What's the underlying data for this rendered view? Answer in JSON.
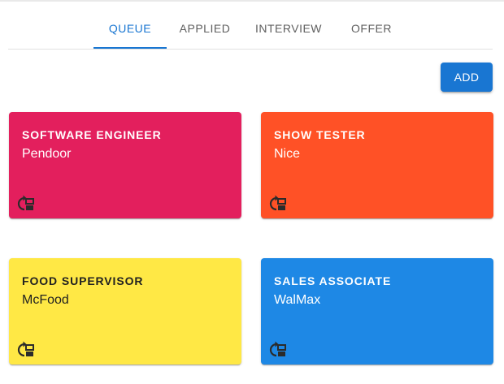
{
  "tabs": [
    {
      "label": "QUEUE",
      "active": true
    },
    {
      "label": "APPLIED",
      "active": false
    },
    {
      "label": "INTERVIEW",
      "active": false
    },
    {
      "label": "OFFER",
      "active": false
    }
  ],
  "toolbar": {
    "add_label": "ADD",
    "add_color": "#1976d2"
  },
  "cards": [
    {
      "title": "SOFTWARE ENGINEER",
      "company": "Pendoor",
      "color": "#e31f5d",
      "text_color": "#ffffff",
      "icon": "move-to-column-icon"
    },
    {
      "title": "SHOW TESTER",
      "company": "Nice",
      "color": "#ff5126",
      "text_color": "#ffffff",
      "icon": "move-to-column-icon"
    },
    {
      "title": "FOOD SUPERVISOR",
      "company": "McFood",
      "color": "#ffe845",
      "text_color": "#212121",
      "icon": "move-to-column-icon"
    },
    {
      "title": "SALES ASSOCIATE",
      "company": "WalMax",
      "color": "#1e88e5",
      "text_color": "#ffffff",
      "icon": "move-to-column-icon"
    }
  ]
}
